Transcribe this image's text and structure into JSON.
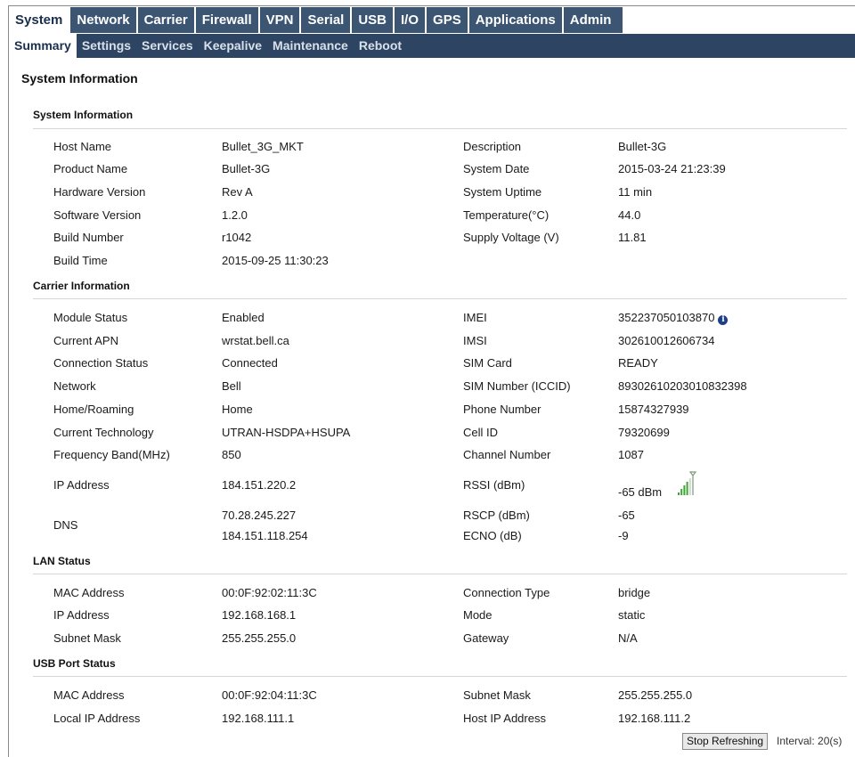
{
  "nav": {
    "primary_tabs": [
      "System",
      "Network",
      "Carrier",
      "Firewall",
      "VPN",
      "Serial",
      "USB",
      "I/O",
      "GPS",
      "Applications",
      "Admin"
    ],
    "secondary_tabs": [
      "Summary",
      "Settings",
      "Services",
      "Keepalive",
      "Maintenance",
      "Reboot"
    ]
  },
  "page_title": "System Information",
  "system": {
    "title": "System Information",
    "host_name_label": "Host Name",
    "host_name": "Bullet_3G_MKT",
    "description_label": "Description",
    "description": "Bullet-3G",
    "product_name_label": "Product Name",
    "product_name": "Bullet-3G",
    "system_date_label": "System Date",
    "system_date": "2015-03-24 21:23:39",
    "hardware_version_label": "Hardware Version",
    "hardware_version": "Rev A",
    "system_uptime_label": "System Uptime",
    "system_uptime": "11 min",
    "software_version_label": "Software Version",
    "software_version": "1.2.0",
    "temperature_label": "Temperature(°C)",
    "temperature": "44.0",
    "build_number_label": "Build Number",
    "build_number": "r1042",
    "supply_voltage_label": "Supply Voltage (V)",
    "supply_voltage": "11.81",
    "build_time_label": "Build Time",
    "build_time": "2015-09-25 11:30:23"
  },
  "carrier": {
    "title": "Carrier Information",
    "module_status_label": "Module Status",
    "module_status": "Enabled",
    "imei_label": "IMEI",
    "imei": "352237050103870",
    "current_apn_label": "Current APN",
    "current_apn": "wrstat.bell.ca",
    "imsi_label": "IMSI",
    "imsi": "302610012606734",
    "connection_status_label": "Connection Status",
    "connection_status": "Connected",
    "sim_card_label": "SIM Card",
    "sim_card": "READY",
    "network_label": "Network",
    "network": "Bell",
    "sim_number_label": "SIM Number (ICCID)",
    "sim_number": "89302610203010832398",
    "home_roaming_label": "Home/Roaming",
    "home_roaming": "Home",
    "phone_number_label": "Phone Number",
    "phone_number": "15874327939",
    "current_technology_label": "Current Technology",
    "current_technology": "UTRAN-HSDPA+HSUPA",
    "cell_id_label": "Cell ID",
    "cell_id": "79320699",
    "frequency_band_label": "Frequency Band(MHz)",
    "frequency_band": "850",
    "channel_number_label": "Channel Number",
    "channel_number": "1087",
    "ip_address_label": "IP Address",
    "ip_address": "184.151.220.2",
    "rssi_label": "RSSI (dBm)",
    "rssi": "-65 dBm",
    "dns_label": "DNS",
    "dns_1": "70.28.245.227",
    "dns_2": "184.151.118.254",
    "rscp_label": "RSCP (dBm)",
    "rscp": "-65",
    "ecno_label": "ECNO (dB)",
    "ecno": "-9",
    "signal_bars": 4,
    "signal_bars_max": 5,
    "signal_color": "#3fa535"
  },
  "lan": {
    "title": "LAN Status",
    "mac_address_label": "MAC Address",
    "mac_address": "00:0F:92:02:11:3C",
    "connection_type_label": "Connection Type",
    "connection_type": "bridge",
    "ip_address_label": "IP Address",
    "ip_address": "192.168.168.1",
    "mode_label": "Mode",
    "mode": "static",
    "subnet_mask_label": "Subnet Mask",
    "subnet_mask": "255.255.255.0",
    "gateway_label": "Gateway",
    "gateway": "N/A"
  },
  "usb": {
    "title": "USB Port Status",
    "mac_address_label": "MAC Address",
    "mac_address": "00:0F:92:04:11:3C",
    "subnet_mask_label": "Subnet Mask",
    "subnet_mask": "255.255.255.0",
    "local_ip_label": "Local IP Address",
    "local_ip": "192.168.111.1",
    "host_ip_label": "Host IP Address",
    "host_ip": "192.168.111.2"
  },
  "footer": {
    "stop_button": "Stop Refreshing",
    "interval": "Interval: 20(s)"
  },
  "colors": {
    "nav_primary_bg": "#3b5573",
    "nav_secondary_bg": "#2d4463",
    "active_tab_bg": "#ffffff"
  }
}
